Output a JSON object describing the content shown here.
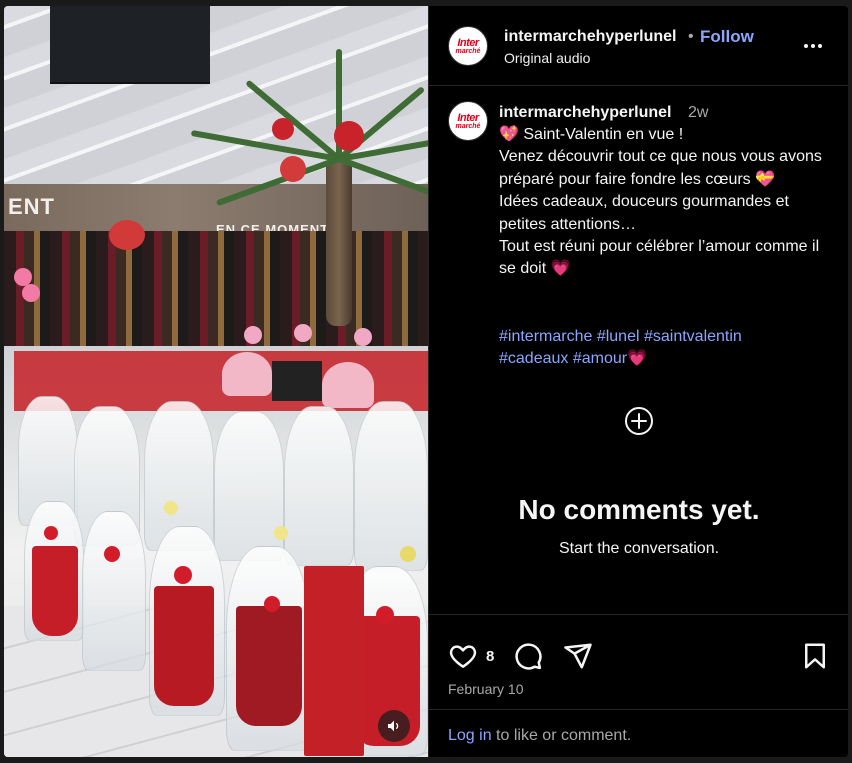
{
  "post": {
    "username": "intermarchehyperlunel",
    "follow_label": "Follow",
    "dot": "•",
    "audio_label": "Original audio",
    "time_ago": "2w",
    "avatar_logo_top": "Inter",
    "avatar_logo_bottom": "marché",
    "caption_text": "💖 Saint-Valentin en vue !\nVenez découvrir tout ce que nous vous avons préparé pour faire fondre les cœurs 💝\nIdées cadeaux, douceurs gourmandes et petites attentions…\nTout est réuni pour célébrer l’amour comme il se doit 💗",
    "hashtags": [
      "#intermarche",
      "#lunel",
      "#saintvalentin",
      "#cadeaux",
      "#amour"
    ],
    "hashtag_trailing_emoji": "💗",
    "media_sign_left": "ENT",
    "media_sign_right": "EN CE MOMENT"
  },
  "comments": {
    "empty_title": "No comments yet.",
    "empty_subtitle": "Start the conversation."
  },
  "actions": {
    "like_count": "8",
    "date": "February 10",
    "icons": [
      "heart-icon",
      "comment-icon",
      "share-icon",
      "bookmark-icon"
    ]
  },
  "footer": {
    "login_label": "Log in",
    "rest_label": "to like or comment."
  },
  "colors": {
    "background": "#000000",
    "link": "#8aa6ff",
    "muted": "#a8a8a8",
    "text": "#f5f5f5",
    "brand_red": "#e2001a"
  }
}
